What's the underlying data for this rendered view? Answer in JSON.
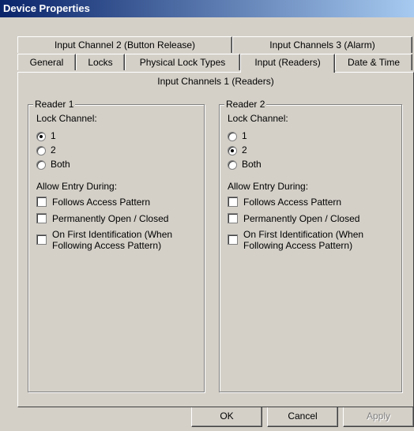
{
  "window": {
    "title": "Device Properties"
  },
  "tabs": {
    "row_back": [
      {
        "label": "Input Channel 2 (Button Release)"
      },
      {
        "label": "Input Channels 3 (Alarm)"
      }
    ],
    "row_front": [
      {
        "label": "General"
      },
      {
        "label": "Locks"
      },
      {
        "label": "Physical Lock Types"
      },
      {
        "label": "Input (Readers)",
        "selected": true
      },
      {
        "label": "Date & Time"
      }
    ]
  },
  "panel": {
    "title": "Input Channels 1 (Readers)"
  },
  "readers": [
    {
      "title": "Reader 1",
      "lock_channel_label": "Lock Channel:",
      "lock_options": [
        "1",
        "2",
        "Both"
      ],
      "selected_lock": "1",
      "entry_label": "Allow Entry During:",
      "entry_options": [
        {
          "label": "Follows Access Pattern",
          "checked": false
        },
        {
          "label": "Permanently Open / Closed",
          "checked": false
        },
        {
          "label": "On First Identification (When Following Access Pattern)",
          "line1": "On First Identification (When",
          "line2": "Following Access Pattern)",
          "checked": false
        }
      ]
    },
    {
      "title": "Reader 2",
      "lock_channel_label": "Lock Channel:",
      "lock_options": [
        "1",
        "2",
        "Both"
      ],
      "selected_lock": "2",
      "entry_label": "Allow Entry During:",
      "entry_options": [
        {
          "label": "Follows Access Pattern",
          "checked": false
        },
        {
          "label": "Permanently Open / Closed",
          "checked": false
        },
        {
          "label": "On First Identification (When Following Access Pattern)",
          "line1": "On First Identification (When",
          "line2": "Following Access Pattern)",
          "checked": false
        }
      ]
    }
  ],
  "buttons": {
    "ok": {
      "label": "OK",
      "enabled": true
    },
    "cancel": {
      "label": "Cancel",
      "enabled": true
    },
    "apply": {
      "label": "Apply",
      "enabled": false
    }
  }
}
